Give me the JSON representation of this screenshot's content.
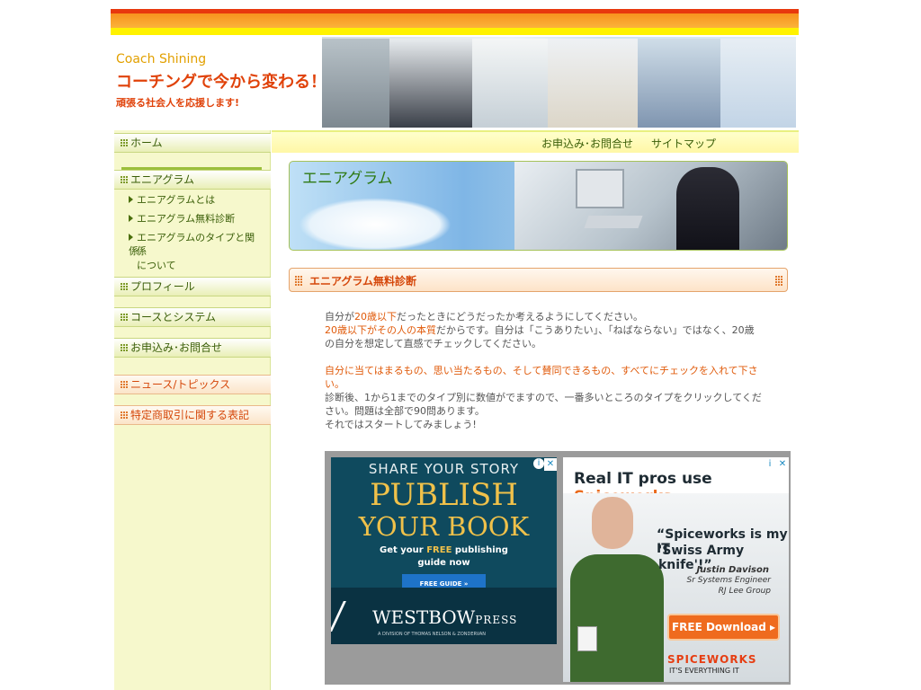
{
  "header": {
    "brand": "Coach Shining",
    "catchphrase": "コーチングで今から変わる！",
    "subline": "頑張る社会人を応援します!"
  },
  "topnav": {
    "contact": "お申込み･お問合せ",
    "sitemap": "サイトマップ"
  },
  "sidebar": {
    "home": "ホーム",
    "enneagram": "エニアグラム",
    "sub_items": [
      "エニアグラムとは",
      "エニアグラム無料診断",
      "エニアグラムのタイプと関係",
      "について"
    ],
    "sub_item_3_line2": "係",
    "profile": "プロフィール",
    "course": "コースとシステム",
    "contact": "お申込み･お問合せ",
    "news": "ニュース/トピックス",
    "legal": "特定商取引に関する表記"
  },
  "banner": {
    "title": "エニアグラム"
  },
  "section": {
    "title": "エニアグラム無料診断"
  },
  "content": {
    "p1_a": "自分が",
    "p1_b": "20歳以下",
    "p1_c": "だったときにどうだったか考えるようにしてください。",
    "p2_a": "20歳以下がその人の本質",
    "p2_b": "だからです。自分は「こうありたい」、「ねばならない」ではなく、20歳",
    "p2_c": "の自分を想定して直感でチェックしてください。",
    "p3_a": "自分に当てはまるもの、思い当たるもの、そして賛同できるもの、すべてにチェックを入れて下さ",
    "p3_b": "い。",
    "p4_a": "診断後、1から1までのタイプ別に数値がでますので、一番多いところのタイプをクリックしてくだ",
    "p4_b": "さい。問題は全部で90問あります。",
    "p4_c": "それではスタートしてみましょう!"
  },
  "ads": {
    "ad1": {
      "line1": "SHARE YOUR STORY",
      "line2": "PUBLISH",
      "line3": "YOUR BOOK",
      "line4a": "Get your ",
      "line4b": "FREE",
      "line4c": " publishing",
      "line5": "guide now",
      "button": "FREE GUIDE »",
      "brand": "WESTBOW",
      "brand2": "PRESS",
      "tagline": "A DIVISION OF THOMAS NELSON & ZONDERVAN"
    },
    "ad2": {
      "headline_a": "Real IT pros use ",
      "headline_b": "Spiceworks.",
      "quote1": "“Spiceworks is my IT",
      "quote2": "'Swiss Army knife'!”",
      "person": "Justin Davison",
      "role": "Sr Systems Engineer",
      "company": "RJ Lee Group",
      "button": "FREE Download ▸",
      "logo": "SPICEWORKS",
      "tagline": "IT'S EVERYTHING IT"
    }
  },
  "colors": {
    "accent_orange": "#e0420a",
    "nav_green": "#3a5e08",
    "sidebar_bg": "#f6f8cc"
  }
}
